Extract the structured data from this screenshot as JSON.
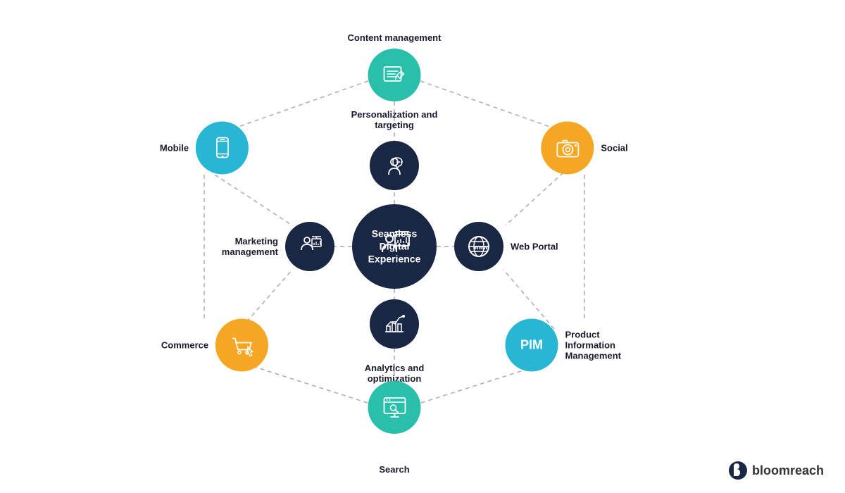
{
  "nodes": {
    "center": {
      "label": "Seamless Digital Experience",
      "icon": "⚡"
    },
    "web_portal": {
      "label": "Web Portal",
      "icon": "🌐"
    },
    "marketing": {
      "label": "Marketing management",
      "icon": "📊"
    },
    "personalization": {
      "label": "Personalization and targeting",
      "icon": "🎯"
    },
    "analytics": {
      "label": "Analytics and optimization",
      "icon": "📈"
    },
    "content": {
      "label": "Content management",
      "icon": "📝"
    },
    "social": {
      "label": "Social",
      "icon": "📷"
    },
    "mobile": {
      "label": "Mobile",
      "icon": "📱"
    },
    "pim": {
      "label": "Product Information Management",
      "pim_text": "PIM",
      "icon": ""
    },
    "commerce": {
      "label": "Commerce",
      "icon": "🛒"
    },
    "search": {
      "label": "Search",
      "icon": "🔍"
    }
  },
  "logo": {
    "text_normal": "bloom",
    "text_bold": "reach"
  }
}
